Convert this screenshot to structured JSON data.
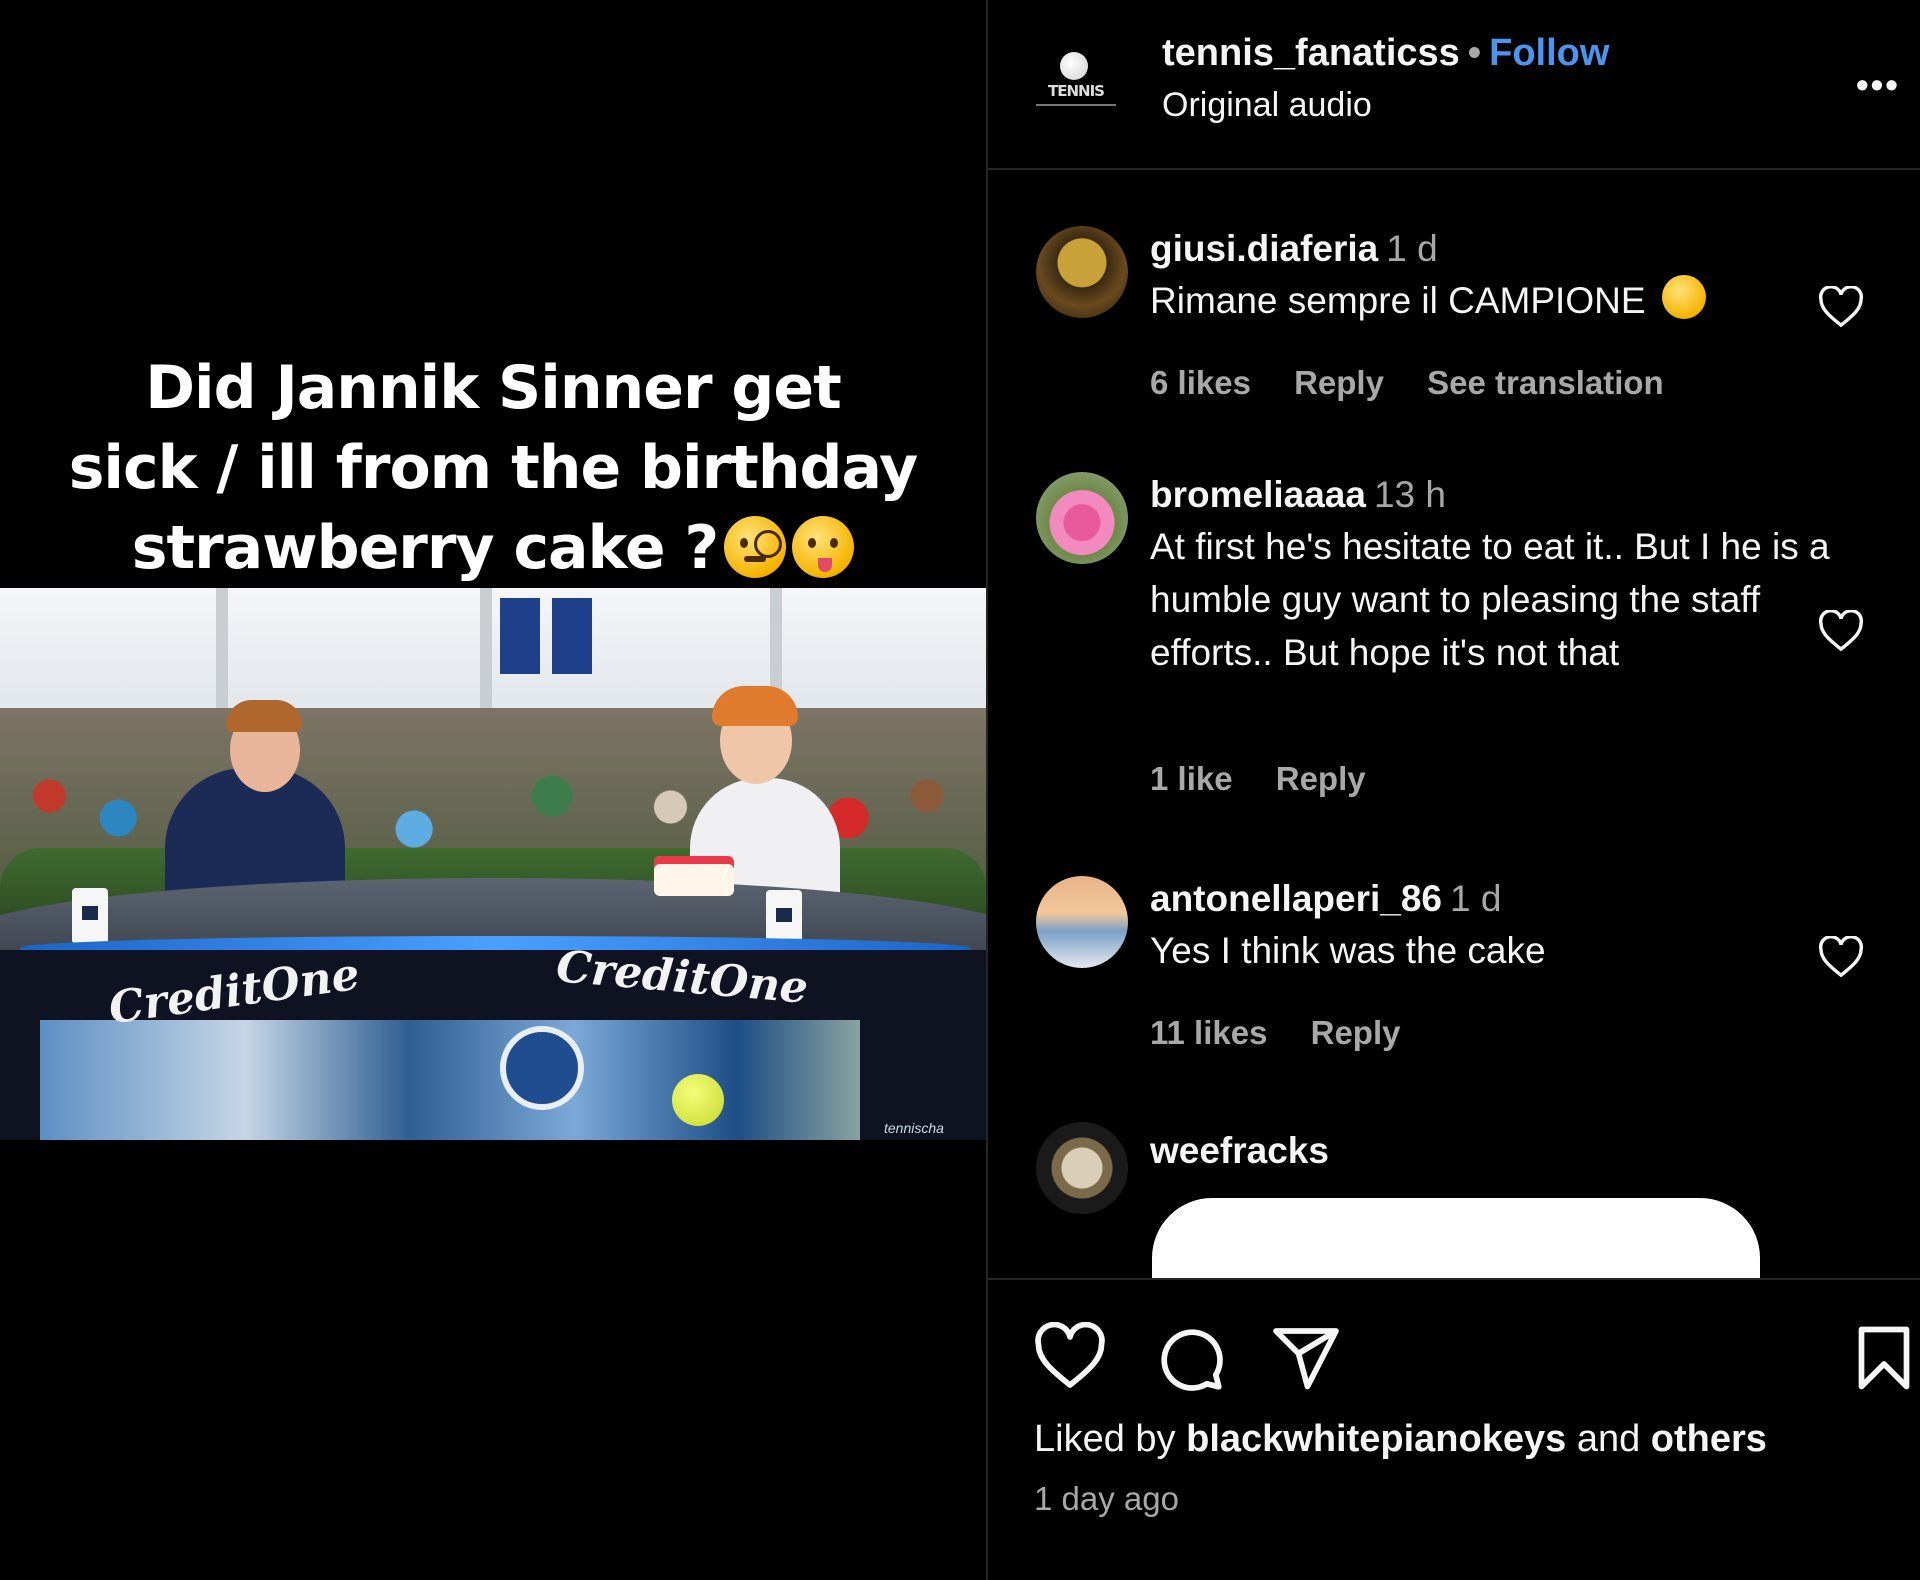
{
  "post": {
    "caption_lines": [
      "Did Jannik Sinner get",
      "sick / ill from the birthday",
      "strawberry cake ?"
    ],
    "caption_emojis": [
      "monocle-face-emoji",
      "woozy-face-emoji"
    ],
    "video": {
      "desk_brand_left": "CreditOne",
      "desk_brand_right": "CreditOne",
      "watermark": "tennischa"
    }
  },
  "header": {
    "username": "tennis_fanaticss",
    "separator": "•",
    "follow_label": "Follow",
    "audio_label": "Original audio",
    "logo_text": "TENNIS",
    "more_label": "•••"
  },
  "comments": [
    {
      "user": "giusi.diaferia",
      "time": "1 d",
      "text": "Rimane sempre il CAMPIONE",
      "emoji": "star-struck-emoji",
      "likes": "6 likes",
      "reply": "Reply",
      "translate": "See translation"
    },
    {
      "user": "bromeliaaaa",
      "time": "13 h",
      "text": "At first he's hesitate to eat it.. But I he is a humble guy want to pleasing the staff efforts.. But hope it's not that",
      "likes": "1 like",
      "reply": "Reply"
    },
    {
      "user": "antonellaperi_86",
      "time": "1 d",
      "text": "Yes I think was the cake",
      "likes": "11 likes",
      "reply": "Reply"
    },
    {
      "user": "weefracks"
    }
  ],
  "footer": {
    "liked_prefix": "Liked by",
    "liked_user": "blackwhitepianokeys",
    "liked_and": "and",
    "liked_others": "others",
    "time_ago": "1 day ago"
  },
  "colors": {
    "background": "#000000",
    "text": "#f5f5f5",
    "secondary": "#a8a8a8",
    "link": "#4a95f0",
    "divider": "#262626"
  }
}
